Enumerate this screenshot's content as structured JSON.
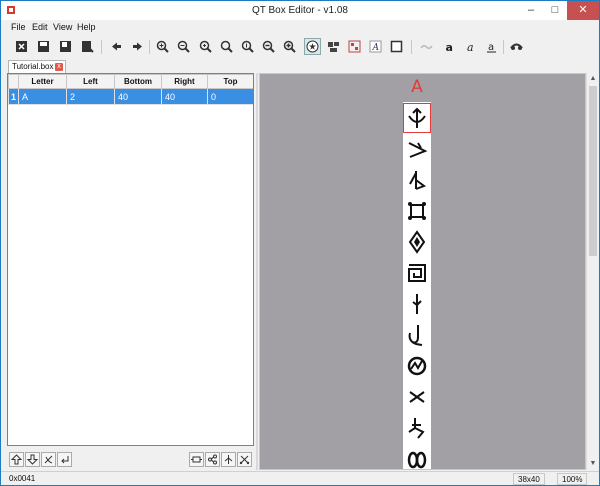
{
  "window": {
    "title": "QT Box Editor - v1.08",
    "minimize_glyph": "–",
    "maximize_glyph": "□",
    "close_glyph": "✕"
  },
  "menu": [
    "File",
    "Edit",
    "View",
    "Help"
  ],
  "toolbar_icons": [
    "close-file-icon",
    "save-icon",
    "save-as-icon",
    "export-icon",
    "arrow-left-icon",
    "arrow-right-icon",
    "zoom-in-icon",
    "zoom-out-icon",
    "zoom-in-small-icon",
    "zoom-fit-icon",
    "zoom-in-large-icon",
    "zoom-out-large-icon",
    "zoom-original-icon",
    "symbol-mode-icon",
    "split-icon",
    "merge-icon",
    "font-icon",
    "box-icon",
    "wave-icon",
    "bold-icon",
    "italic-icon",
    "underline-icon",
    "glasses-icon"
  ],
  "tab": {
    "label": "Tutorial.box *",
    "close_glyph": "x"
  },
  "table": {
    "columns": [
      "Letter",
      "Left",
      "Bottom",
      "Right",
      "Top"
    ],
    "rows": [
      {
        "num": "1",
        "letter": "A",
        "left": "2",
        "bottom": "40",
        "right": "40",
        "top": "0"
      }
    ]
  },
  "bottom_buttons": [
    "move-up-icon",
    "move-down-icon",
    "delete-icon",
    "return-icon",
    "join-icon",
    "split-row-icon",
    "tree-icon",
    "cut-icon"
  ],
  "canvas": {
    "current_letter": "A",
    "glyph_icons": [
      "glyph-arrow-up",
      "glyph-angle",
      "glyph-twist",
      "glyph-square-crossed",
      "glyph-diamond",
      "glyph-spiral",
      "glyph-needle",
      "glyph-hook",
      "glyph-circle-zigzag",
      "glyph-cross",
      "glyph-knot",
      "glyph-double-loop"
    ]
  },
  "status": {
    "code": "0x0041",
    "size": "38x40",
    "zoom": "100%"
  },
  "colors": {
    "selection": "#3a8fe3",
    "accent_red": "#e23a3a",
    "canvas_bg": "#a2a0a5"
  }
}
